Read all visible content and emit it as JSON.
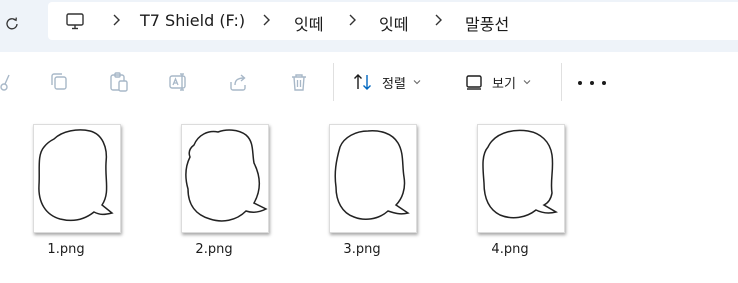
{
  "address": {
    "crumbs": [
      "T7 Shield (F:)",
      "잇떼",
      "잇떼",
      "말풍선"
    ]
  },
  "toolbar": {
    "sort_label": "정렬",
    "view_label": "보기"
  },
  "files": [
    {
      "name": "1.png"
    },
    {
      "name": "2.png"
    },
    {
      "name": "3.png"
    },
    {
      "name": "4.png"
    }
  ],
  "colors": {
    "top_bg": "#eef3f9",
    "icon_disabled": "#a8b8c8",
    "text": "#1b1b1b"
  }
}
